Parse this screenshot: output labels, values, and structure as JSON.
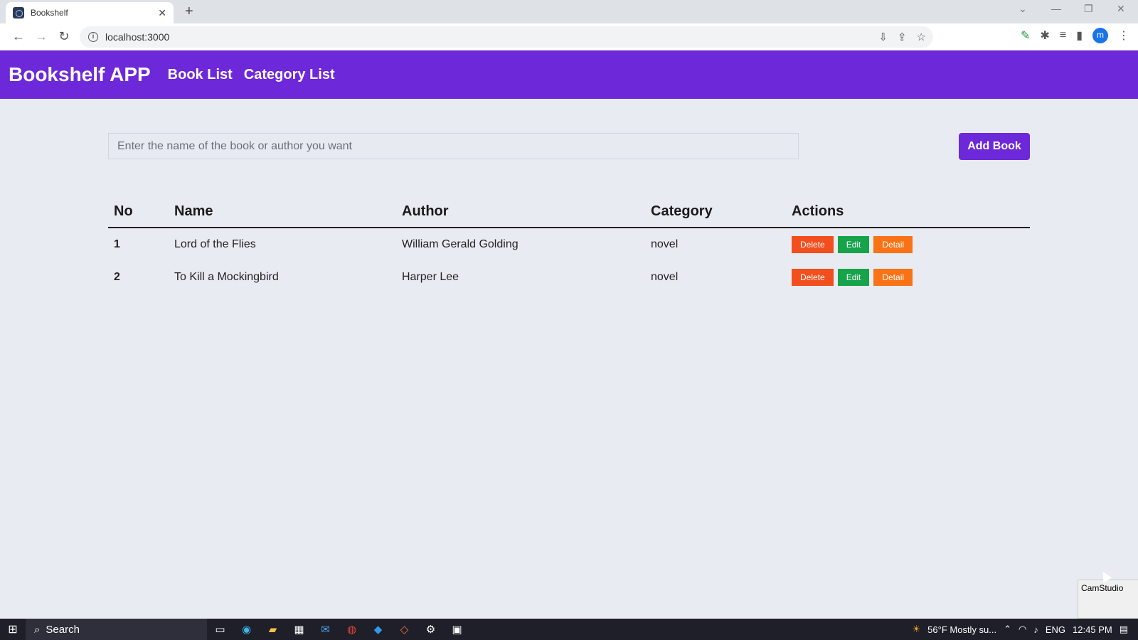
{
  "browser": {
    "tab_title": "Bookshelf",
    "tab_close": "✕",
    "new_tab": "+",
    "url": "localhost:3000",
    "avatar_letter": "m"
  },
  "navbar": {
    "brand": "Bookshelf APP",
    "links": [
      "Book List",
      "Category List"
    ]
  },
  "search": {
    "placeholder": "Enter the name of the book or author you want"
  },
  "add_button": "Add Book",
  "table": {
    "headers": [
      "No",
      "Name",
      "Author",
      "Category",
      "Actions"
    ],
    "rows": [
      {
        "no": "1",
        "name": "Lord of the Flies",
        "author": "William Gerald Golding",
        "category": "novel"
      },
      {
        "no": "2",
        "name": "To Kill a Mockingbird",
        "author": "Harper Lee",
        "category": "novel"
      }
    ],
    "actions": [
      "Delete",
      "Edit",
      "Detail"
    ]
  },
  "camstudio": "CamStudio",
  "taskbar": {
    "search": "Search",
    "weather": "56°F  Mostly su...",
    "lang": "ENG",
    "time": "12:45 PM"
  },
  "colors": {
    "primary": "#6d28d9",
    "delete": "#f24e1e",
    "edit": "#16a34a",
    "detail": "#f97316"
  }
}
